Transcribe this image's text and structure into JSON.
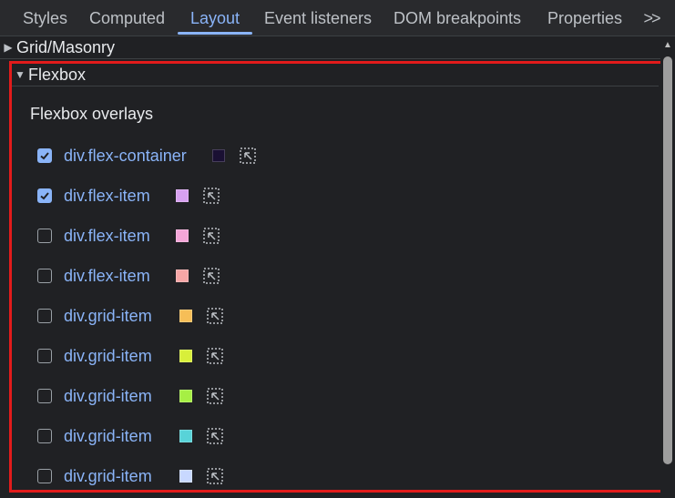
{
  "tabs": [
    {
      "label": "Styles"
    },
    {
      "label": "Computed"
    },
    {
      "label": "Layout"
    },
    {
      "label": "Event listeners"
    },
    {
      "label": "DOM breakpoints"
    },
    {
      "label": "Properties"
    }
  ],
  "more_tabs": ">>",
  "sections": {
    "grid_masonry": {
      "label": "Grid/Masonry",
      "expanded": false
    },
    "flexbox": {
      "label": "Flexbox",
      "expanded": true
    }
  },
  "flexbox": {
    "overlay_title": "Flexbox overlays",
    "items": [
      {
        "name": "div.flex-container",
        "checked": true,
        "color": "#1a1033"
      },
      {
        "name": "div.flex-item",
        "checked": true,
        "color": "#d7a1f0"
      },
      {
        "name": "div.flex-item",
        "checked": false,
        "color": "#f4a6d8"
      },
      {
        "name": "div.flex-item",
        "checked": false,
        "color": "#f6a6a6"
      },
      {
        "name": "div.grid-item",
        "checked": false,
        "color": "#f6be57"
      },
      {
        "name": "div.grid-item",
        "checked": false,
        "color": "#d8ef3a"
      },
      {
        "name": "div.grid-item",
        "checked": false,
        "color": "#a6ef44"
      },
      {
        "name": "div.grid-item",
        "checked": false,
        "color": "#58d3d8"
      },
      {
        "name": "div.grid-item",
        "checked": false,
        "color": "#c8d8ff"
      }
    ]
  },
  "colors": {
    "accent": "#8ab4f8",
    "highlight_border": "#e21b1b"
  }
}
